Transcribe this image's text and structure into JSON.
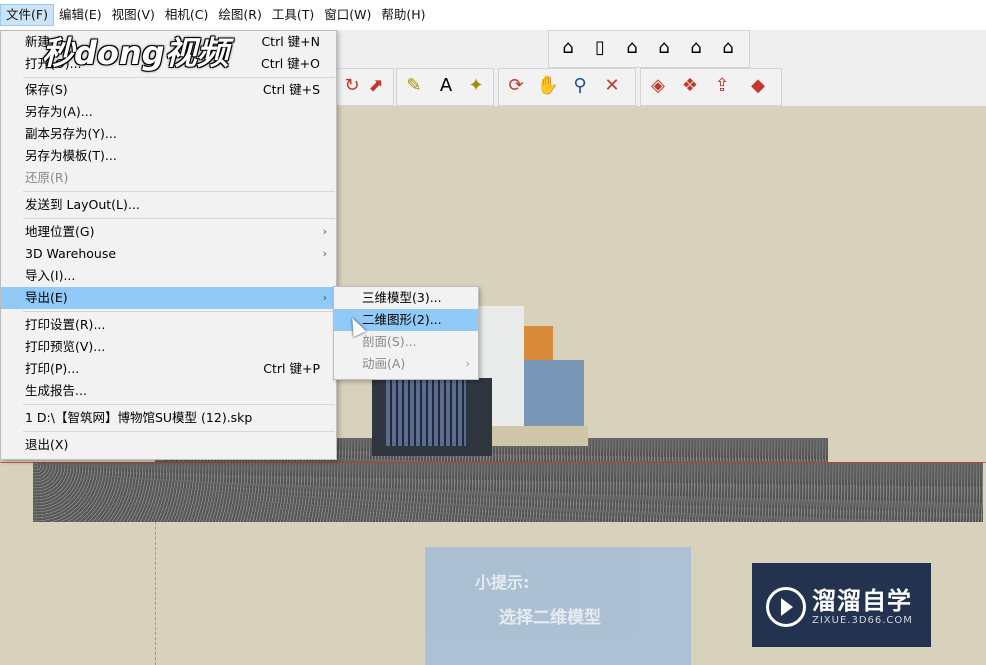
{
  "menubar": {
    "items": [
      "文件(F)",
      "编辑(E)",
      "视图(V)",
      "相机(C)",
      "绘图(R)",
      "工具(T)",
      "窗口(W)",
      "帮助(H)"
    ],
    "active_index": 0
  },
  "watermark_top": "秒dong视频",
  "file_menu": {
    "items": [
      {
        "label": "新建",
        "shortcut": "Ctrl 键+N"
      },
      {
        "label": "打开(O)...",
        "shortcut": "Ctrl 键+O"
      },
      {
        "label": "保存(S)",
        "shortcut": "Ctrl 键+S"
      },
      {
        "label": "另存为(A)...",
        "shortcut": ""
      },
      {
        "label": "副本另存为(Y)...",
        "shortcut": ""
      },
      {
        "label": "另存为模板(T)...",
        "shortcut": ""
      },
      {
        "label": "还原(R)",
        "shortcut": "",
        "disabled": true
      },
      {
        "label": "发送到 LayOut(L)...",
        "shortcut": ""
      },
      {
        "label": "地理位置(G)",
        "shortcut": "",
        "submenu": true
      },
      {
        "label": "3D Warehouse",
        "shortcut": "",
        "submenu": true
      },
      {
        "label": "导入(I)...",
        "shortcut": ""
      },
      {
        "label": "导出(E)",
        "shortcut": "",
        "submenu": true,
        "highlighted": true
      },
      {
        "label": "打印设置(R)...",
        "shortcut": ""
      },
      {
        "label": "打印预览(V)...",
        "shortcut": ""
      },
      {
        "label": "打印(P)...",
        "shortcut": "Ctrl 键+P"
      },
      {
        "label": "生成报告...",
        "shortcut": ""
      },
      {
        "label": "1 D:\\【智筑网】博物馆SU模型 (12).skp",
        "shortcut": ""
      },
      {
        "label": "退出(X)",
        "shortcut": ""
      }
    ]
  },
  "export_submenu": {
    "items": [
      {
        "label": "三维模型(3)..."
      },
      {
        "label": "二维图形(2)...",
        "highlighted": true
      },
      {
        "label": "剖面(S)...",
        "disabled": true
      },
      {
        "label": "动画(A)",
        "disabled": true,
        "submenu": true
      }
    ]
  },
  "tip": {
    "title": "小提示:",
    "text": "选择二维模型"
  },
  "brand": {
    "name": "溜溜自学",
    "url": "ZIXUE.3D66.COM"
  },
  "toolbar_icons": {
    "views": [
      "iso-view-icon",
      "front-door-view-icon",
      "top-house-view-icon",
      "right-view-icon",
      "back-view-icon",
      "left-view-icon"
    ],
    "tools": [
      "paint-bucket-icon",
      "move-icon",
      "tape-measure-icon",
      "text-label-icon",
      "follow-me-icon",
      "orbit-icon",
      "pan-icon",
      "zoom-icon",
      "zoom-extents-icon",
      "components-icon",
      "materials-icon",
      "export-icon",
      "ruby-icon"
    ]
  }
}
